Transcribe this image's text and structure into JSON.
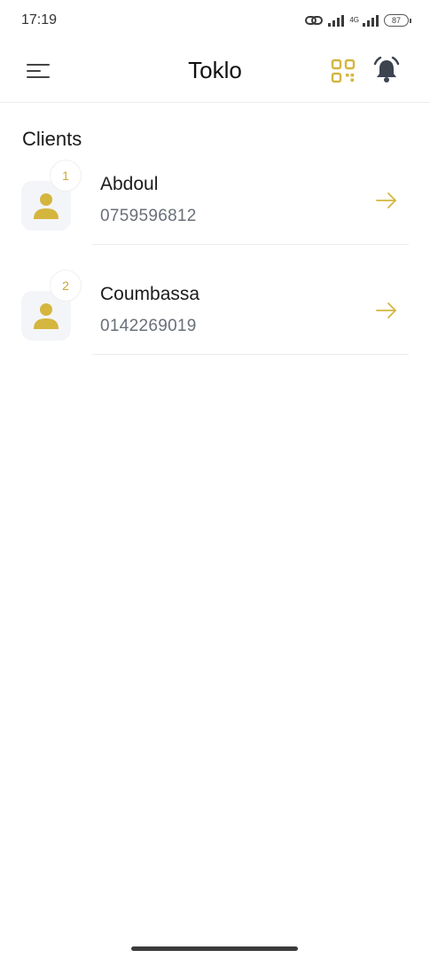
{
  "status": {
    "time": "17:19",
    "network": "4G",
    "battery": "87"
  },
  "header": {
    "title": "Toklo"
  },
  "section": {
    "title": "Clients"
  },
  "clients": [
    {
      "index": "1",
      "name": "Abdoul",
      "phone": "0759596812"
    },
    {
      "index": "2",
      "name": "Coumbassa",
      "phone": "0142269019"
    }
  ],
  "colors": {
    "accent": "#d4b63f",
    "icon_gray": "#3d4450"
  },
  "icons": [
    "menu-icon",
    "qr-code-icon",
    "bell-icon",
    "person-icon",
    "arrow-right-icon",
    "link-icon"
  ]
}
